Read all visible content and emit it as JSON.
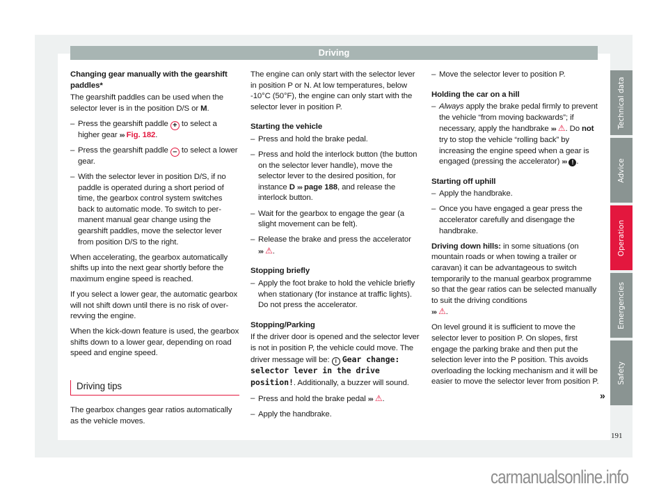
{
  "header": {
    "title": "Driving"
  },
  "col1": {
    "heading": "Changing gear manually with the gearshift paddles*",
    "intro_pre": "The gearshift paddles can be used when the selector lever is in the position D/S or ",
    "intro_bold": "M",
    "intro_post": ".",
    "b1_pre": "Press the gearshift paddle ",
    "b1_icon": "+",
    "b1_mid": " to select a higher gear ",
    "b1_ref": "Fig. 182",
    "b1_post": ".",
    "b2_pre": "Press the gearshift paddle ",
    "b2_icon": "–",
    "b2_post": " to select a lower gear.",
    "b3": "With the selector lever in position D/S, if no paddle is operated during a short period of time, the gearbox control system switches back to automatic mode. To switch to per­manent manual gear change using the gearshift paddles, move the selector lever from position D/S to the right.",
    "p1": "When accelerating, the gearbox automatical­ly shifts up into the next gear shortly before the maximum engine speed is reached.",
    "p2": "If you select a lower gear, the automatic gear­box will not shift down until there is no risk of over-revving the engine.",
    "p3": "When the kick-down feature is used, the gearbox shifts down to a lower gear, depend­ing on road speed and engine speed.",
    "section_title": "Driving tips",
    "p4": "The gearbox changes gear ratios automatical­ly as the vehicle moves."
  },
  "col2": {
    "p1": "The engine can only start with the selector lever in position P or N. At low temperatures, below -10°C (50°F), the engine can only start with the selector lever in position P.",
    "h1": "Starting the vehicle",
    "b1": "Press and hold the brake pedal.",
    "b2_pre": "Press and hold the interlock button (the button on the selector lever handle), move the selector lever to the desired position, for instance ",
    "b2_bold": "D",
    "b2_ref": "page 188",
    "b2_post": ", and release the interlock button.",
    "b3": "Wait for the gearbox to engage the gear (a slight movement can be felt).",
    "b4": "Release the brake and press the accelerator",
    "h2": "Stopping briefly",
    "b5": "Apply the foot brake to hold the vehicle briefly when stationary (for instance at traf­fic lights). Do not press the accelerator.",
    "h3": "Stopping/Parking",
    "p2_pre": "If the driver door is opened and the selector lever is not in position P, the vehicle could move. The driver message will be: ",
    "p2_mono": "Gear change: selector lever in the drive position!",
    "p2_post": ". Additionally, a buzzer will sound.",
    "b6": "Press and hold the brake pedal",
    "b7": "Apply the handbrake."
  },
  "col3": {
    "b1": "Move the selector lever to position P.",
    "h1": "Holding the car on a hill",
    "b2_italic": "Always",
    "b2_a": " apply the brake pedal firmly to pre­vent the vehicle “from moving backwards”; if necessary, apply the handbrake ",
    "b2_b": ". Do ",
    "b2_bold": "not",
    "b2_c": " try to stop the vehicle “rolling back” by increasing the engine speed when a gear is engaged (pressing the accelerator) ",
    "b2_d": ".",
    "h2": "Starting off uphill",
    "b3": "Apply the handbrake.",
    "b4": "Once you have engaged a gear press the accelerator carefully and disengage the handbrake.",
    "p1_bold": "Driving down hills:",
    "p1": " in some situations (on mountain roads or when towing a trailer or caravan) it can be advantageous to switch temporarily to the manual gearbox pro­gramme so that the gear ratios can be selec­ted manually to suit the driving conditions",
    "p2": "On level ground it is sufficient to move the selector lever to position P. On slopes, first engage the parking brake and then put the selection lever into the P position. This avoids overloading the locking mechanism and it will be easier to move the selector lev­er from position P."
  },
  "symbols": {
    "ref_arrow": "›››",
    "warning": "⚠",
    "note": "!",
    "info": "i",
    "continue": "»"
  },
  "side_tabs": [
    {
      "label": "Technical data",
      "active": false
    },
    {
      "label": "Advice",
      "active": false
    },
    {
      "label": "Operation",
      "active": true
    },
    {
      "label": "Emergencies",
      "active": false
    },
    {
      "label": "Safety",
      "active": false
    }
  ],
  "page_number": "191",
  "watermark": "carmanualsonline.info",
  "colors": {
    "accent": "#e3173e",
    "tab": "#8a9492",
    "header": "#a8b5b3"
  }
}
